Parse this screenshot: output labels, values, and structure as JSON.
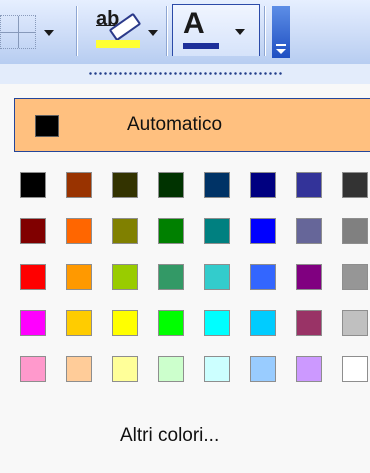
{
  "toolbar": {
    "highlight_glyph": "ab",
    "font_color_glyph": "A",
    "icons": [
      "borders-icon",
      "highlight-icon",
      "font-color-icon",
      "toolbar-options-icon"
    ]
  },
  "color_menu": {
    "automatic_label": "Automatico",
    "automatic_color": "#000000",
    "more_colors_label": "Altri colori...",
    "palette": [
      [
        "#000000",
        "#993300",
        "#333300",
        "#003300",
        "#003366",
        "#000080",
        "#333399",
        "#333333"
      ],
      [
        "#800000",
        "#FF6600",
        "#808000",
        "#008000",
        "#008080",
        "#0000FF",
        "#666699",
        "#808080"
      ],
      [
        "#FF0000",
        "#FF9900",
        "#99CC00",
        "#339966",
        "#33CCCC",
        "#3366FF",
        "#800080",
        "#969696"
      ],
      [
        "#FF00FF",
        "#FFCC00",
        "#FFFF00",
        "#00FF00",
        "#00FFFF",
        "#00CCFF",
        "#993366",
        "#C0C0C0"
      ],
      [
        "#FF99CC",
        "#FFCC99",
        "#FFFF99",
        "#CCFFCC",
        "#CCFFFF",
        "#99CCFF",
        "#CC99FF",
        "#FFFFFF"
      ]
    ]
  }
}
